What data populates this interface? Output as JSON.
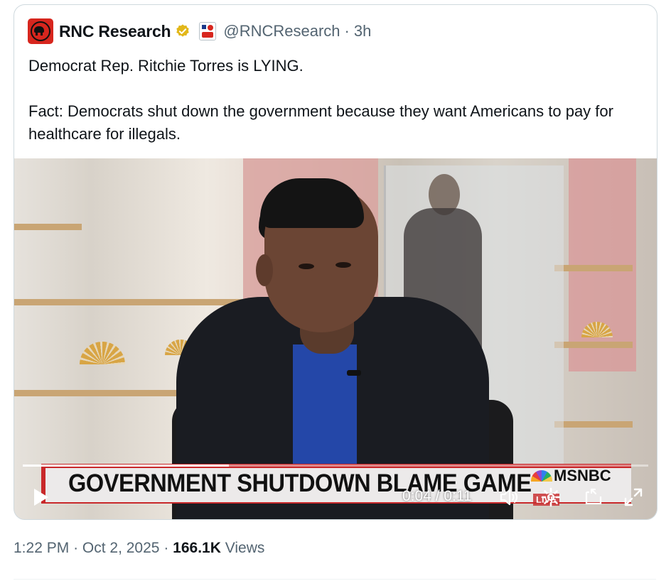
{
  "author": {
    "name": "RNC Research",
    "handle": "@RNCResearch",
    "separator": "·",
    "time": "3h",
    "avatar_icon": "republican-elephant-icon",
    "verified_color": "#e2b719"
  },
  "tweet": {
    "line1": "Democrat Rep. Ritchie Torres is LYING.",
    "line2": "Fact: Democrats shut down the government because they want Americans to pay for healthcare for illegals."
  },
  "video": {
    "chyron": "GOVERNMENT SHUTDOWN BLAME GAME",
    "network": "MSNBC",
    "live_badge": "LIVE",
    "time_display": "0:04 / 0:11",
    "progress": 0.33
  },
  "footer": {
    "time": "1:22 PM",
    "sep1": "·",
    "date": "Oct 2, 2025",
    "sep2": "·",
    "views_count": "166.1K",
    "views_label": "Views"
  },
  "colors": {
    "text": "#0f1419",
    "secondary": "#536471",
    "border": "#cfd9de",
    "chyron_red": "#c8282a"
  }
}
